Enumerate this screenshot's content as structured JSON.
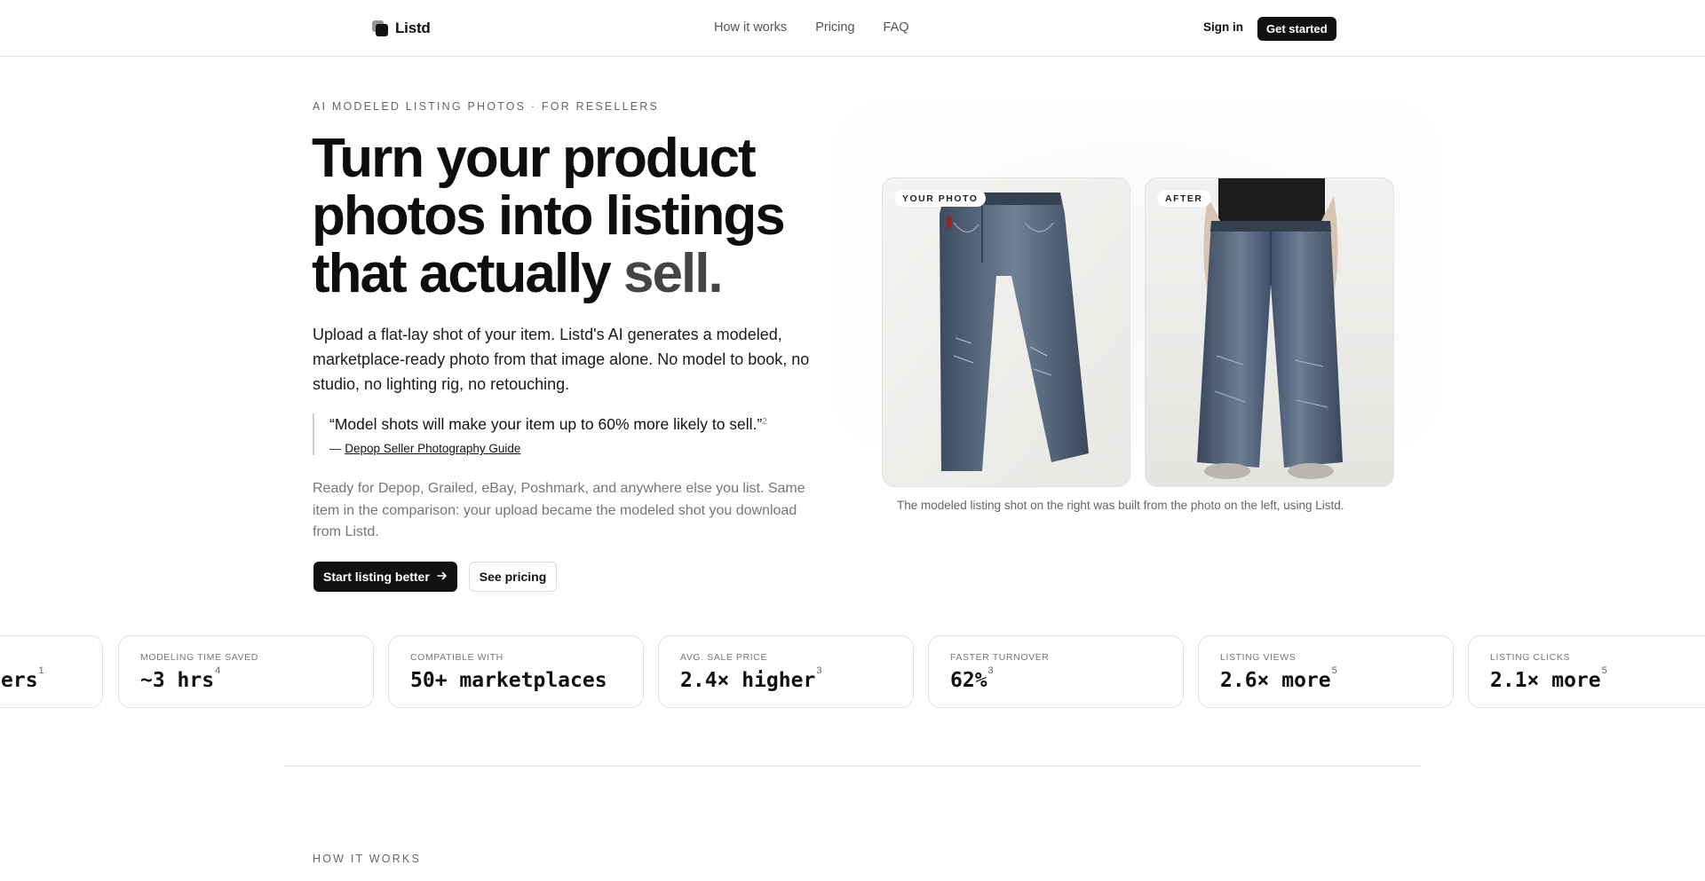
{
  "nav": {
    "brand": "Listd",
    "links": [
      "How it works",
      "Pricing",
      "FAQ"
    ],
    "signin": "Sign in",
    "cta": "Get started"
  },
  "hero": {
    "eyebrow": "AI MODELED LISTING PHOTOS · FOR RESELLERS",
    "headline_main": "Turn your product photos into listings that actually ",
    "headline_accent": "sell.",
    "lede": "Upload a flat-lay shot of your item. Listd's AI generates a modeled, marketplace-ready photo from that image alone. No model to book, no studio, no lighting rig, no retouching.",
    "quote": "“Model shots will make your item up to 60% more likely to sell.”",
    "quote_ref": "2",
    "quote_dash": "— ",
    "quote_source": "Depop Seller Photography Guide",
    "note": "Ready for Depop, Grailed, eBay, Poshmark, and anywhere else you list. Same item in the comparison: your upload became the modeled shot you download from Listd.",
    "primary_cta": "Start listing better",
    "primary_cta_icon": "arrow-right-icon",
    "secondary_cta": "See pricing"
  },
  "comparison": {
    "before_label": "YOUR PHOTO",
    "after_label": "AFTER",
    "caption": "The modeled listing shot on the right was built from the photo on the left, using Listd."
  },
  "stats": [
    {
      "label": "",
      "value": "ers",
      "ref": "1"
    },
    {
      "label": "MODELING TIME SAVED",
      "value": "~3 hrs",
      "ref": "4"
    },
    {
      "label": "COMPATIBLE WITH",
      "value": "50+ marketplaces",
      "ref": ""
    },
    {
      "label": "AVG. SALE PRICE",
      "value": "2.4× higher",
      "ref": "3"
    },
    {
      "label": "FASTER TURNOVER",
      "value": "62%",
      "ref": "3"
    },
    {
      "label": "LISTING VIEWS",
      "value": "2.6× more",
      "ref": "5"
    },
    {
      "label": "LISTING CLICKS",
      "value": "2.1× more",
      "ref": "5"
    }
  ],
  "how_it_works": {
    "eyebrow": "HOW IT WORKS"
  },
  "colors": {
    "primary": "#111111",
    "muted": "#777777",
    "border": "#e3e3e3",
    "denim": "#4a5a70"
  }
}
